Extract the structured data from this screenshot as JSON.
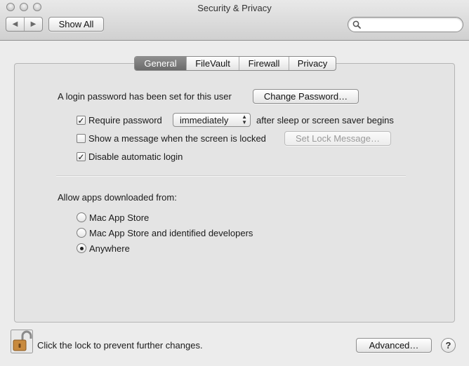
{
  "window": {
    "title": "Security & Privacy"
  },
  "toolbar": {
    "back_icon": "chevron-left-icon",
    "forward_icon": "chevron-right-icon",
    "show_all_label": "Show All",
    "search_placeholder": ""
  },
  "tabs": [
    {
      "label": "General",
      "active": true
    },
    {
      "label": "FileVault",
      "active": false
    },
    {
      "label": "Firewall",
      "active": false
    },
    {
      "label": "Privacy",
      "active": false
    }
  ],
  "general": {
    "login_password_text": "A login password has been set for this user",
    "change_password_label": "Change Password…",
    "require_password": {
      "label": "Require password",
      "checked": true,
      "selected_option": "immediately",
      "suffix": "after sleep or screen saver begins"
    },
    "show_message": {
      "label": "Show a message when the screen is locked",
      "checked": false,
      "button_label": "Set Lock Message…"
    },
    "disable_auto_login": {
      "label": "Disable automatic login",
      "checked": true
    }
  },
  "gatekeeper": {
    "heading": "Allow apps downloaded from:",
    "options": [
      {
        "label": "Mac App Store",
        "selected": false
      },
      {
        "label": "Mac App Store and identified developers",
        "selected": false
      },
      {
        "label": "Anywhere",
        "selected": true
      }
    ]
  },
  "footer": {
    "lock_text": "Click the lock to prevent further changes.",
    "advanced_label": "Advanced…",
    "help_label": "?"
  },
  "colors": {
    "active_tab": "#7a7a7a",
    "lock_body": "#c88a3e"
  }
}
